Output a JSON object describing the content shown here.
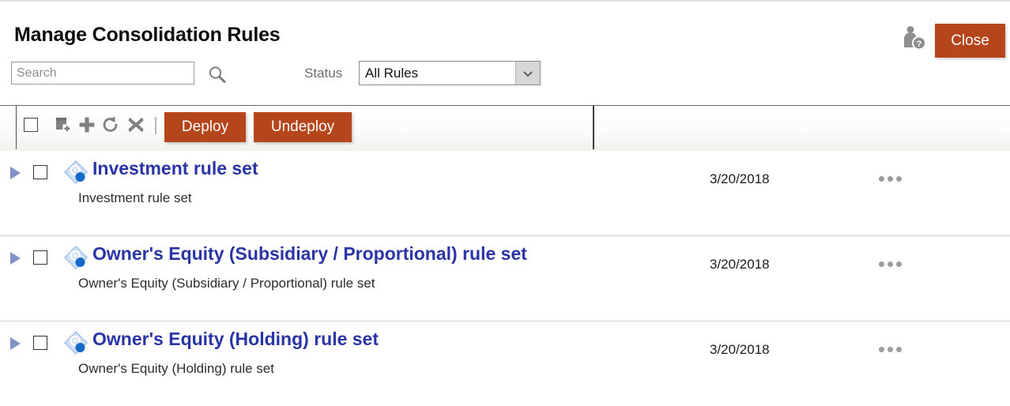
{
  "header": {
    "title": "Manage Consolidation Rules",
    "search": {
      "placeholder": "Search",
      "value": "",
      "icon": "search-icon"
    },
    "status_filter": {
      "label": "Status",
      "selected": "All Rules",
      "options": [
        "All Rules"
      ]
    },
    "help_icon": "user-help-icon",
    "close_label": "Close"
  },
  "toolbar": {
    "select_all_checked": false,
    "icons": [
      {
        "name": "copy-add-icon",
        "title": "Copy"
      },
      {
        "name": "plus-icon",
        "title": "Add"
      },
      {
        "name": "refresh-icon",
        "title": "Refresh"
      },
      {
        "name": "delete-x-icon",
        "title": "Delete"
      }
    ],
    "deploy_label": "Deploy",
    "undeploy_label": "Undeploy"
  },
  "rules": [
    {
      "title": "Investment rule set",
      "description": "Investment rule set",
      "date": "3/20/2018",
      "checked": false,
      "expanded": false,
      "icon": "rule-set-icon",
      "menu_icon": "more-options-icon"
    },
    {
      "title": "Owner's Equity (Subsidiary / Proportional) rule set",
      "description": "Owner's Equity (Subsidiary / Proportional) rule set",
      "date": "3/20/2018",
      "checked": false,
      "expanded": false,
      "icon": "rule-set-icon",
      "menu_icon": "more-options-icon"
    },
    {
      "title": "Owner's Equity (Holding) rule set",
      "description": "Owner's Equity (Holding) rule set",
      "date": "3/20/2018",
      "checked": false,
      "expanded": false,
      "icon": "rule-set-icon",
      "menu_icon": "more-options-icon"
    }
  ],
  "colors": {
    "accent_orange": "#b5451a",
    "link_blue": "#2a35a5",
    "icon_blue": "#1469c7",
    "toolbar_gray": "#7a7a7a"
  }
}
